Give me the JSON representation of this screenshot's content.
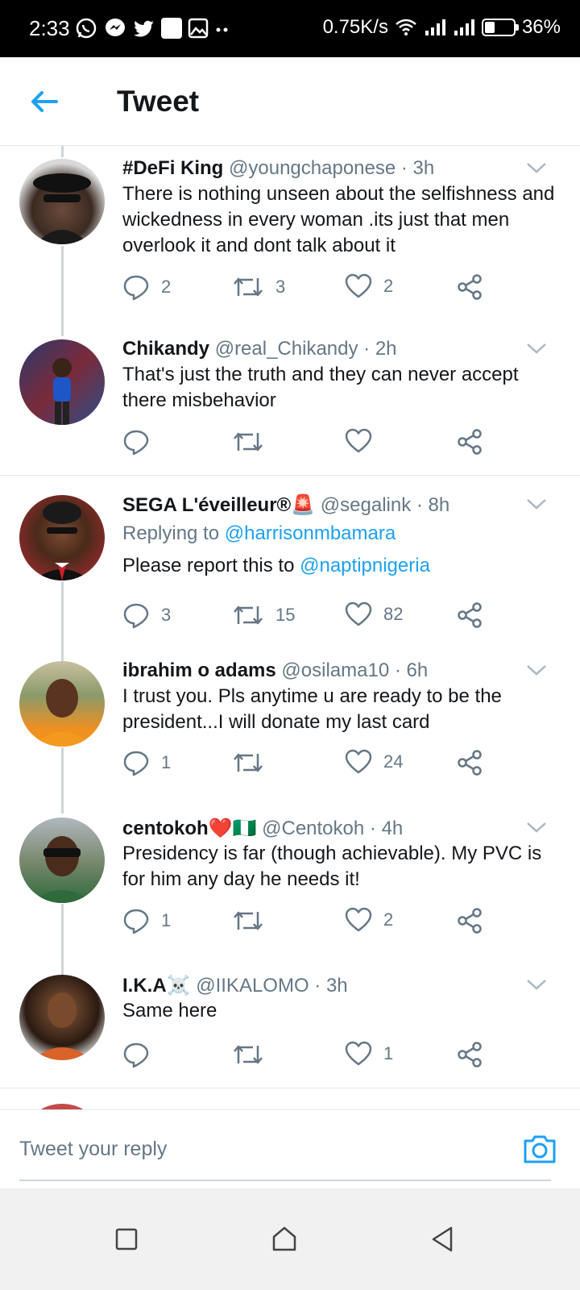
{
  "status_bar": {
    "time": "2:33",
    "network_speed": "0.75K/s",
    "battery": "36%",
    "battery_level": 0.36,
    "notification_icons": [
      "whatsapp-icon",
      "messenger-icon",
      "twitter-icon",
      "app-icon",
      "gallery-icon",
      "more-dots-icon"
    ]
  },
  "header": {
    "title": "Tweet"
  },
  "tweets": [
    {
      "name": "#DeFi King",
      "handle": "@youngchaponese",
      "time": "· 3h",
      "text": "There is nothing unseen about the selfishness and wickedness in every woman .its just that men overlook it and dont talk about it",
      "replies": "2",
      "retweets": "3",
      "likes": "2"
    },
    {
      "name": "Chikandy",
      "handle": "@real_Chikandy",
      "time": "· 2h",
      "text": "That's just the truth and they can never accept there misbehavior",
      "replies": "",
      "retweets": "",
      "likes": ""
    },
    {
      "name": "SEGA L'éveilleur®🚨",
      "handle": "@segalink",
      "time": "· 8h",
      "replying_prefix": "Replying to",
      "replying_to": "@harrisonmbamara",
      "text": "Please report this to",
      "mention": "@naptipnigeria",
      "replies": "3",
      "retweets": "15",
      "likes": "82"
    },
    {
      "name": "ibrahim o adams",
      "handle": "@osilama10",
      "time": "· 6h",
      "text": "I trust you.  Pls anytime u are ready to be the president...I will donate my last card",
      "replies": "1",
      "retweets": "",
      "likes": "24"
    },
    {
      "name": "centokoh❤️🇳🇬",
      "handle": "@Centokoh",
      "time": "· 4h",
      "text": "Presidency is far (though achievable). My PVC is for him any day he needs it!",
      "replies": "1",
      "retweets": "",
      "likes": "2"
    },
    {
      "name": "I.K.A☠️",
      "handle": "@IIKALOMO",
      "time": "· 3h",
      "text": "Same here",
      "replies": "",
      "retweets": "",
      "likes": "1"
    }
  ],
  "reply_bar": {
    "placeholder": "Tweet your reply"
  },
  "colors": {
    "accent": "#1da1f2",
    "secondary_text": "#657786",
    "primary_text": "#14171a",
    "divider": "#e1e8ed"
  }
}
